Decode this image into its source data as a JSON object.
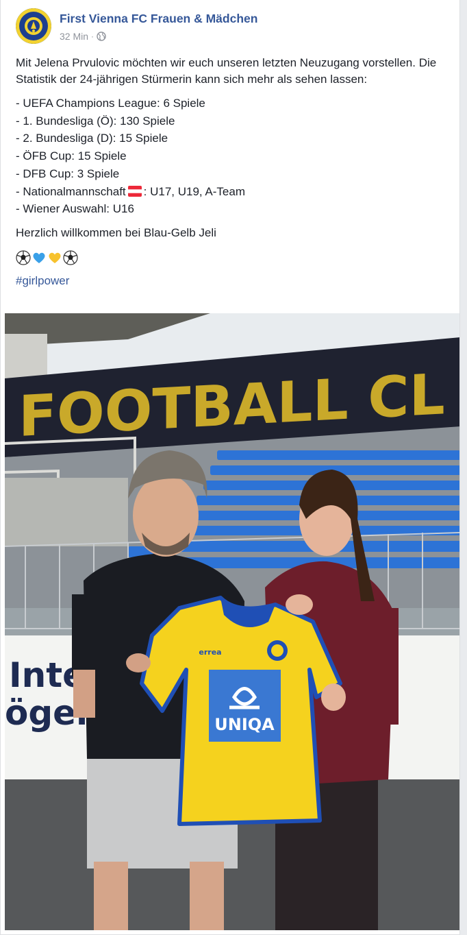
{
  "post": {
    "page_name": "First Vienna FC Frauen & Mädchen",
    "time": "32 Min",
    "separator": "·",
    "privacy_icon": "globe-icon",
    "intro": "Mit Jelena Prvulovic möchten wir euch unseren letzten Neuzugang vorstellen. Die Statistik der 24-jährigen Stürmerin kann sich mehr als sehen lassen:",
    "stats": [
      "- UEFA Champions League: 6 Spiele",
      "- 1. Bundesliga (Ö): 130 Spiele",
      "- 2. Bundesliga (D): 15 Spiele",
      "- ÖFB Cup: 15 Spiele",
      "- DFB Cup: 3 Spiele"
    ],
    "national_prefix": "- Nationalmannschaft",
    "national_suffix": ": U17, U19, A-Team",
    "last_stat": "- Wiener Auswahl: U16",
    "welcome": "Herzlich willkommen bei Blau-Gelb Jeli",
    "emojis": [
      "soccer-ball-emoji",
      "blue-heart-emoji",
      "yellow-heart-emoji",
      "soccer-ball-emoji"
    ],
    "hashtag": "#girlpower"
  },
  "photo": {
    "stand_sign": "FOOTBALL CL",
    "wall_text_line1": "Internat",
    "wall_text_line2": "ögensplo",
    "jersey_brand": "errea",
    "jersey_sponsor": "UNIQA",
    "colors": {
      "jersey_yellow": "#f5d21e",
      "jersey_blue": "#1f4fb5",
      "seats_blue": "#2d73d6",
      "sponsor_blue": "#3a78d2",
      "link_blue": "#365899"
    }
  }
}
